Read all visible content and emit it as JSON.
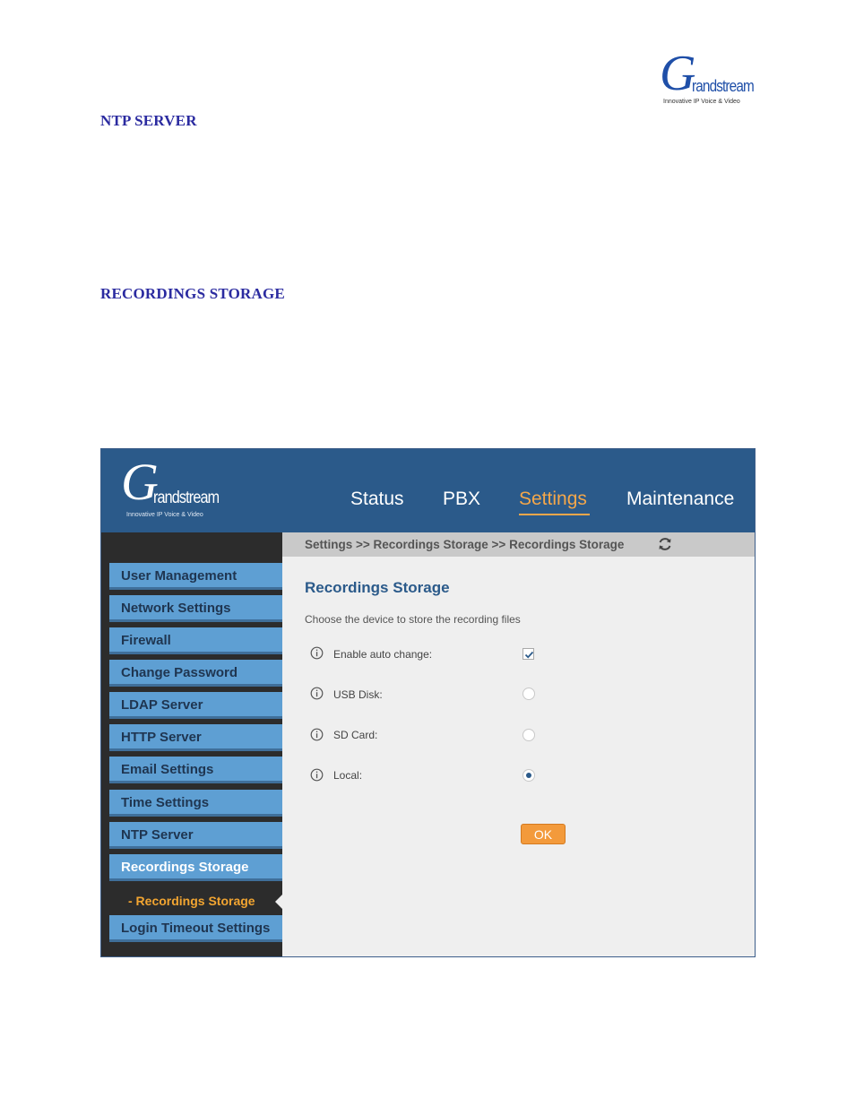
{
  "page": {
    "logo": {
      "mark": "G",
      "brand": "randstream",
      "tagline": "Innovative IP Voice & Video"
    },
    "headings": [
      "NTP SERVER",
      "RECORDINGS STORAGE"
    ]
  },
  "screenshot": {
    "logo": {
      "mark": "G",
      "brand": "randstream",
      "tagline": "Innovative IP Voice & Video"
    },
    "nav": [
      "Status",
      "PBX",
      "Settings",
      "Maintenance"
    ],
    "active_nav": "Settings",
    "sidebar": {
      "items": [
        "User Management",
        "Network Settings",
        "Firewall",
        "Change Password",
        "LDAP Server",
        "HTTP Server",
        "Email Settings",
        "Time Settings",
        "NTP Server",
        "Recordings Storage"
      ],
      "active_item": "Recordings Storage",
      "sub_item": "- Recordings Storage",
      "last_item": "Login Timeout Settings"
    },
    "breadcrumb": "Settings >> Recordings Storage >> Recordings Storage",
    "content": {
      "title": "Recordings Storage",
      "description": "Choose the device to store the recording files",
      "rows": [
        {
          "label": "Enable auto change:",
          "control": "checkbox",
          "checked": true
        },
        {
          "label": "USB Disk:",
          "control": "radio",
          "checked": false
        },
        {
          "label": "SD Card:",
          "control": "radio",
          "checked": false
        },
        {
          "label": "Local:",
          "control": "radio",
          "checked": true
        }
      ],
      "ok_label": "OK"
    },
    "colors": {
      "header": "#2b5a8a",
      "accent": "#f4a74a",
      "sidebar_button": "#5e9fd3",
      "sidebar_bg": "#2c2c2c"
    }
  }
}
